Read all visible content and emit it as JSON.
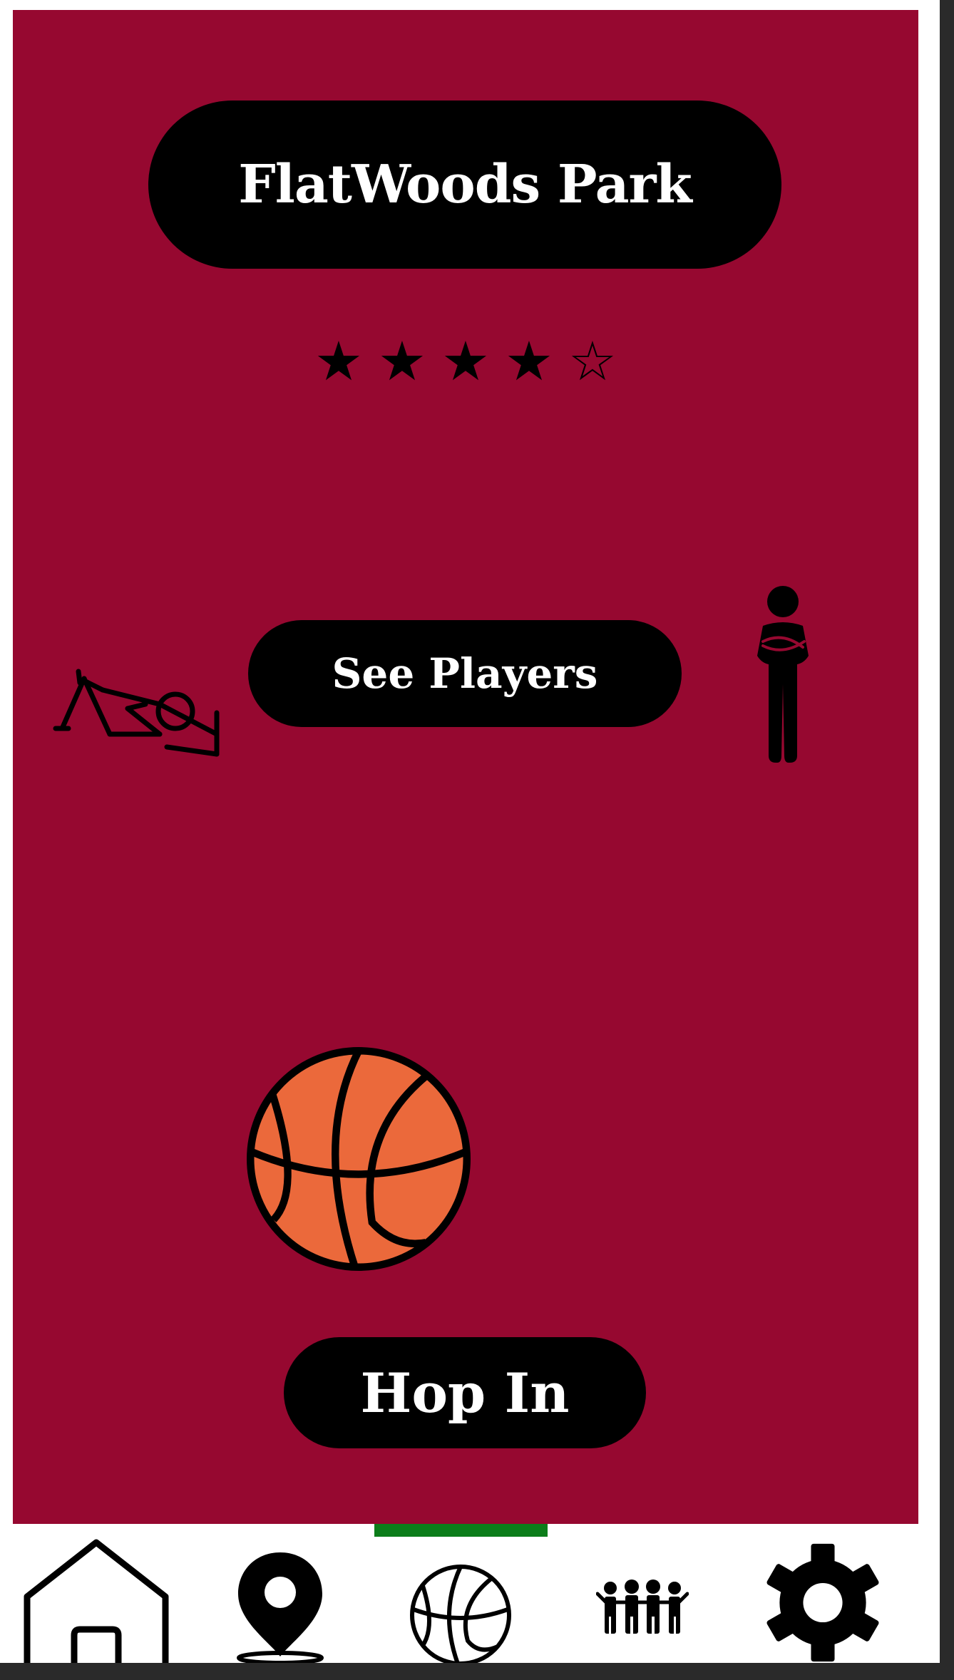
{
  "court": {
    "name": "FlatWoods Park",
    "rating": 4,
    "rating_max": 5,
    "stars": [
      "★",
      "★",
      "★",
      "★",
      "☆"
    ]
  },
  "actions": {
    "see_players": "See Players",
    "hop_in": "Hop In"
  },
  "icons": {
    "left_figure": "reclining-player-icon",
    "right_figure": "standing-player-icon",
    "ball": "basketball-icon"
  },
  "nav": {
    "active_index": 2,
    "items": [
      {
        "name": "home",
        "icon": "home-icon"
      },
      {
        "name": "map",
        "icon": "map-pin-icon"
      },
      {
        "name": "courts",
        "icon": "basketball-icon"
      },
      {
        "name": "friends",
        "icon": "group-icon"
      },
      {
        "name": "settings",
        "icon": "gear-icon"
      }
    ]
  },
  "colors": {
    "background": "#960830",
    "pill": "#000000",
    "pill_text": "#ffffff",
    "ball": "#eb693b",
    "nav_active": "#0c7d1a"
  }
}
